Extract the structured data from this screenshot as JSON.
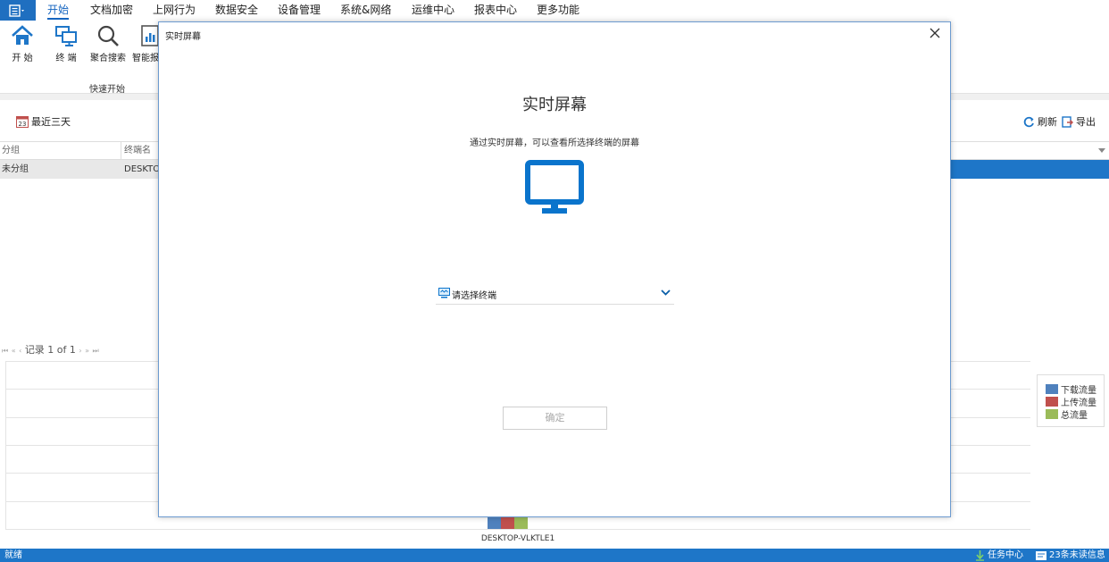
{
  "menu": {
    "app_icon": "menu-icon",
    "items": [
      "开始",
      "文档加密",
      "上网行为",
      "数据安全",
      "设备管理",
      "系统&网络",
      "运维中心",
      "报表中心",
      "更多功能"
    ]
  },
  "ribbon": {
    "buttons": [
      {
        "label": "开 始",
        "icon": "home-icon"
      },
      {
        "label": "终 端",
        "icon": "terminals-icon"
      },
      {
        "label": "聚合搜索",
        "icon": "search-icon"
      },
      {
        "label": "智能报",
        "icon": "report-icon"
      }
    ],
    "group_label": "快速开始"
  },
  "toolbar": {
    "date_range": "最近三天",
    "calendar_day": "23",
    "refresh": "刷新",
    "export": "导出"
  },
  "grid": {
    "columns": [
      "分组",
      "终端名"
    ],
    "rows": [
      {
        "group": "未分组",
        "name": "DESKTO"
      }
    ]
  },
  "pager": {
    "record_text": "记录 1 of 1"
  },
  "chart_data": {
    "type": "bar",
    "categories": [
      "DESKTOP-VLKTLE1"
    ],
    "series": [
      {
        "name": "下载流量",
        "values": [
          0.4
        ],
        "color": "#4f81bd"
      },
      {
        "name": "上传流量",
        "values": [
          0.4
        ],
        "color": "#c0504d"
      },
      {
        "name": "总流量",
        "values": [
          0.4
        ],
        "color": "#9bbb59"
      }
    ],
    "ylim": [
      0,
      6
    ],
    "grid": true,
    "legend": "right",
    "title": "",
    "xlabel": "",
    "ylabel": ""
  },
  "statusbar": {
    "left": "就绪",
    "task_center": "任务中心",
    "unread": "23条未读信息"
  },
  "modal": {
    "title": "实时屏幕",
    "heading": "实时屏幕",
    "description": "通过实时屏幕，可以查看所选择终端的屏幕",
    "select_placeholder": "请选择终端",
    "ok_label": "确定",
    "accent": "#0a74cc"
  }
}
